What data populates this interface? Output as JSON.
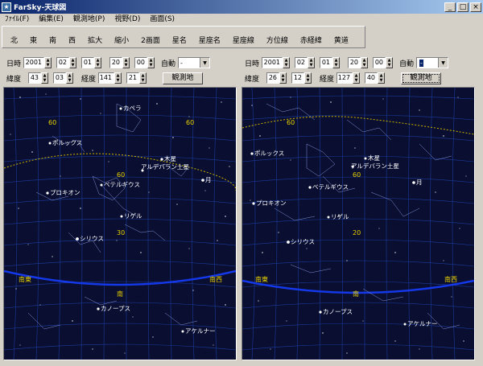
{
  "window": {
    "title": "FarSky-天球図",
    "min": "_",
    "max": "□",
    "close": "×"
  },
  "menu": [
    {
      "label": "ﾌｧｲﾙ(F)"
    },
    {
      "label": "編集(E)"
    },
    {
      "label": "観測地(P)"
    },
    {
      "label": "視野(D)"
    },
    {
      "label": "画面(S)"
    }
  ],
  "toolbar": [
    {
      "label": "北"
    },
    {
      "label": "東"
    },
    {
      "label": "南"
    },
    {
      "label": "西"
    },
    {
      "label": "拡大"
    },
    {
      "label": "縮小"
    },
    {
      "label": "2画面"
    },
    {
      "label": "星名"
    },
    {
      "label": "星座名"
    },
    {
      "label": "星座線"
    },
    {
      "label": "方位線"
    },
    {
      "label": "赤経緯"
    },
    {
      "label": "黄道"
    }
  ],
  "colors": {
    "sky": "#0a0f32",
    "grid": "#1c3b9a",
    "horizon": "#1538e8",
    "ecliptic": "#c8b000",
    "label": "#ffffff",
    "degree": "#e8d000",
    "direction": "#e8d000"
  },
  "left": {
    "datetime_label": "日時",
    "year": "2001",
    "month": "02",
    "day": "01",
    "hour": "20",
    "minute": "00",
    "auto_label": "自動",
    "auto_value": "-",
    "lat_label": "緯度",
    "lat_deg": "43",
    "lat_min": "03",
    "lon_label": "経度",
    "lon_deg": "141",
    "lon_min": "21",
    "site_button": "観測地",
    "stars": [
      {
        "label": "カペラ"
      },
      {
        "label": "ポルックス"
      },
      {
        "label": "木星"
      },
      {
        "label": "アルデバラン土星"
      },
      {
        "label": "プロキオン"
      },
      {
        "label": "ベテルギウス"
      },
      {
        "label": "月"
      },
      {
        "label": "リゲル"
      },
      {
        "label": "シリウス"
      },
      {
        "label": "カノープス"
      },
      {
        "label": "アケルナー"
      }
    ],
    "degrees": [
      {
        "label": "60"
      },
      {
        "label": "60"
      },
      {
        "label": "60"
      },
      {
        "label": "30"
      }
    ],
    "directions": [
      {
        "label": "南東"
      },
      {
        "label": "南"
      },
      {
        "label": "南西"
      }
    ]
  },
  "right": {
    "datetime_label": "日時",
    "year": "2001",
    "month": "02",
    "day": "01",
    "hour": "20",
    "minute": "00",
    "auto_label": "自動",
    "auto_value": "-",
    "lat_label": "緯度",
    "lat_deg": "26",
    "lat_min": "12",
    "lon_label": "経度",
    "lon_deg": "127",
    "lon_min": "40",
    "site_button": "観測地",
    "stars": [
      {
        "label": "ポルックス"
      },
      {
        "label": "木星"
      },
      {
        "label": "アルデバラン土星"
      },
      {
        "label": "ベテルギウス"
      },
      {
        "label": "月"
      },
      {
        "label": "プロキオン"
      },
      {
        "label": "リゲル"
      },
      {
        "label": "シリウス"
      },
      {
        "label": "カノープス"
      },
      {
        "label": "アケルナー"
      }
    ],
    "degrees": [
      {
        "label": "60"
      },
      {
        "label": "60"
      },
      {
        "label": "20"
      }
    ],
    "directions": [
      {
        "label": "南東"
      },
      {
        "label": "南"
      },
      {
        "label": "南西"
      }
    ]
  }
}
